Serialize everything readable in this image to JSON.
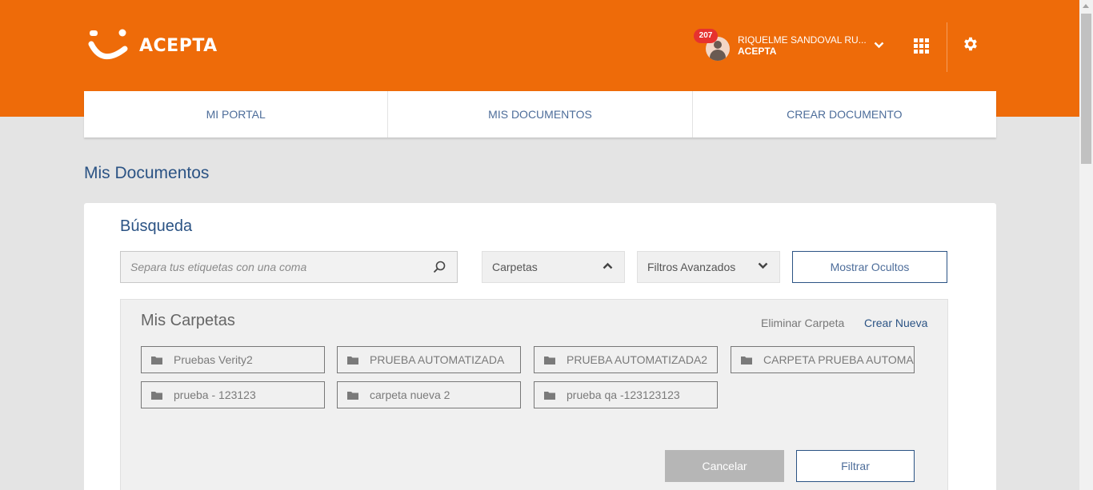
{
  "header": {
    "brand": "ACEPTA",
    "notification_count": "207",
    "user_name": "RIQUELME SANDOVAL RU...",
    "user_company": "ACEPTA",
    "icons": [
      "chevron-down-icon",
      "apps-grid-icon",
      "gear-icon"
    ]
  },
  "nav": {
    "items": [
      {
        "label": "MI PORTAL"
      },
      {
        "label": "MIS DOCUMENTOS"
      },
      {
        "label": "CREAR DOCUMENTO"
      }
    ]
  },
  "page_title": "Mis Documentos",
  "search": {
    "title": "Búsqueda",
    "placeholder": "Separa tus etiquetas con una coma",
    "dropdown_carpetas": "Carpetas",
    "dropdown_filtros": "Filtros Avanzados",
    "show_hidden_label": "Mostrar Ocultos"
  },
  "folders": {
    "title": "Mis Carpetas",
    "delete_label": "Eliminar Carpeta",
    "create_label": "Crear Nueva",
    "items": [
      {
        "name": "Pruebas Verity2"
      },
      {
        "name": "PRUEBA AUTOMATIZADA"
      },
      {
        "name": "PRUEBA AUTOMATIZADA2"
      },
      {
        "name": "CARPETA PRUEBA AUTOMA"
      },
      {
        "name": "prueba - 123123"
      },
      {
        "name": "carpeta nueva 2"
      },
      {
        "name": "prueba qa -123123123"
      }
    ],
    "cancel_label": "Cancelar",
    "filter_label": "Filtrar"
  },
  "colors": {
    "brand_orange": "#ee6b09",
    "primary_blue": "#2b5384",
    "badge_red": "#e6322f"
  }
}
